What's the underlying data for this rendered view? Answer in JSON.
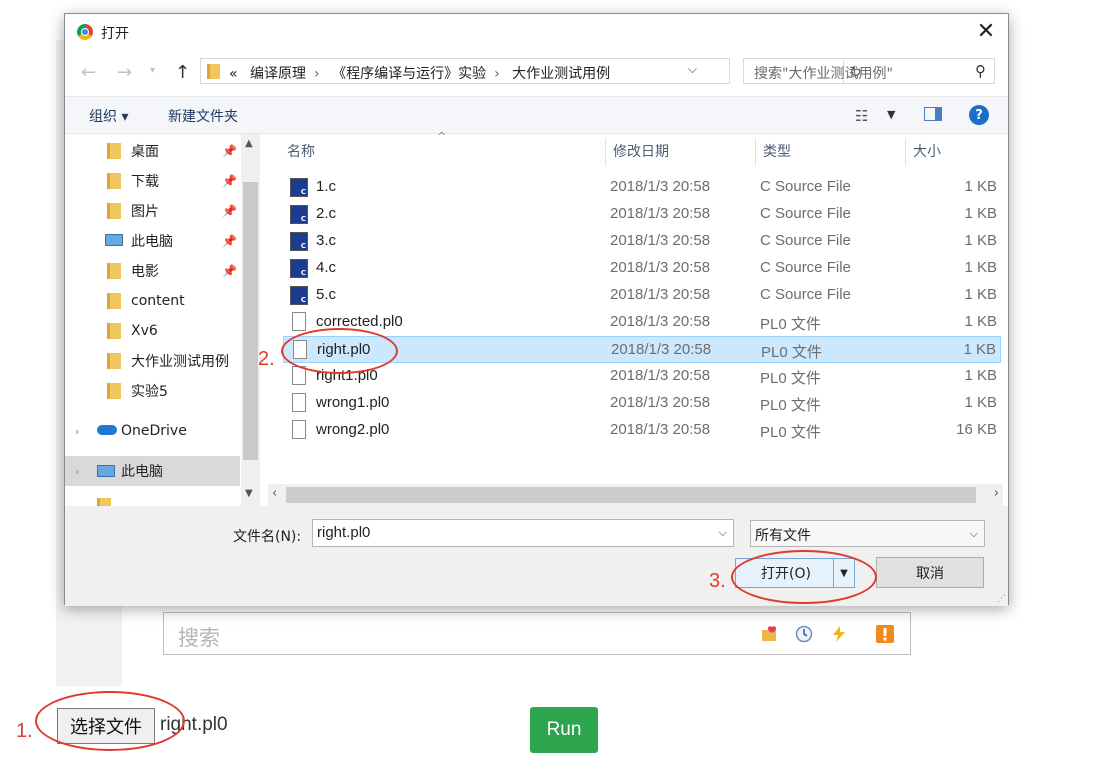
{
  "page": {
    "search_placeholder": "搜索",
    "choose_file_label": "选择文件",
    "chosen_file": "right.pl0",
    "run_label": "Run"
  },
  "annotations": [
    "1.",
    "2.",
    "3."
  ],
  "colors": {
    "annotation_red": "#e03a2f",
    "run_green": "#2da44e",
    "selection_blue": "#cce8ff"
  },
  "dialog": {
    "title": "打开",
    "address": {
      "overflow": "«",
      "crumbs": [
        "编译原理",
        "《程序编译与运行》实验",
        "大作业测试用例"
      ]
    },
    "search_placeholder": "搜索\"大作业测试用例\"",
    "toolbar": {
      "organize": "组织 ▾",
      "new_folder": "新建文件夹"
    },
    "tree": [
      {
        "label": "桌面",
        "icon": "desktop-folder-icon",
        "pinned": true
      },
      {
        "label": "下载",
        "icon": "download-folder-icon",
        "pinned": true
      },
      {
        "label": "图片",
        "icon": "pictures-folder-icon",
        "pinned": true
      },
      {
        "label": "此电脑",
        "icon": "computer-icon",
        "pinned": true
      },
      {
        "label": "电影",
        "icon": "folder-icon",
        "pinned": true
      },
      {
        "label": "content",
        "icon": "folder-icon",
        "pinned": false
      },
      {
        "label": "Xv6",
        "icon": "folder-icon",
        "pinned": false
      },
      {
        "label": "大作业测试用例",
        "icon": "folder-icon",
        "pinned": false
      },
      {
        "label": "实验5",
        "icon": "folder-icon",
        "pinned": false
      },
      {
        "label": "OneDrive",
        "icon": "onedrive-icon",
        "pinned": false
      },
      {
        "label": "此电脑",
        "icon": "computer-icon",
        "pinned": false
      }
    ],
    "columns": {
      "name": "名称",
      "date": "修改日期",
      "type": "类型",
      "size": "大小"
    },
    "files": [
      {
        "name": "1.c",
        "date": "2018/1/3 20:58",
        "type": "C Source File",
        "size": "1 KB",
        "icon": "c-file-icon"
      },
      {
        "name": "2.c",
        "date": "2018/1/3 20:58",
        "type": "C Source File",
        "size": "1 KB",
        "icon": "c-file-icon"
      },
      {
        "name": "3.c",
        "date": "2018/1/3 20:58",
        "type": "C Source File",
        "size": "1 KB",
        "icon": "c-file-icon"
      },
      {
        "name": "4.c",
        "date": "2018/1/3 20:58",
        "type": "C Source File",
        "size": "1 KB",
        "icon": "c-file-icon"
      },
      {
        "name": "5.c",
        "date": "2018/1/3 20:58",
        "type": "C Source File",
        "size": "1 KB",
        "icon": "c-file-icon"
      },
      {
        "name": "corrected.pl0",
        "date": "2018/1/3 20:58",
        "type": "PL0 文件",
        "size": "1 KB",
        "icon": "document-icon"
      },
      {
        "name": "right.pl0",
        "date": "2018/1/3 20:58",
        "type": "PL0 文件",
        "size": "1 KB",
        "icon": "document-icon",
        "selected": true
      },
      {
        "name": "right1.pl0",
        "date": "2018/1/3 20:58",
        "type": "PL0 文件",
        "size": "1 KB",
        "icon": "document-icon"
      },
      {
        "name": "wrong1.pl0",
        "date": "2018/1/3 20:58",
        "type": "PL0 文件",
        "size": "1 KB",
        "icon": "document-icon"
      },
      {
        "name": "wrong2.pl0",
        "date": "2018/1/3 20:58",
        "type": "PL0 文件",
        "size": "16 KB",
        "icon": "document-icon"
      }
    ],
    "filename_label": "文件名(N):",
    "filename_value": "right.pl0",
    "filter_value": "所有文件",
    "open_label": "打开(O)",
    "cancel_label": "取消"
  }
}
